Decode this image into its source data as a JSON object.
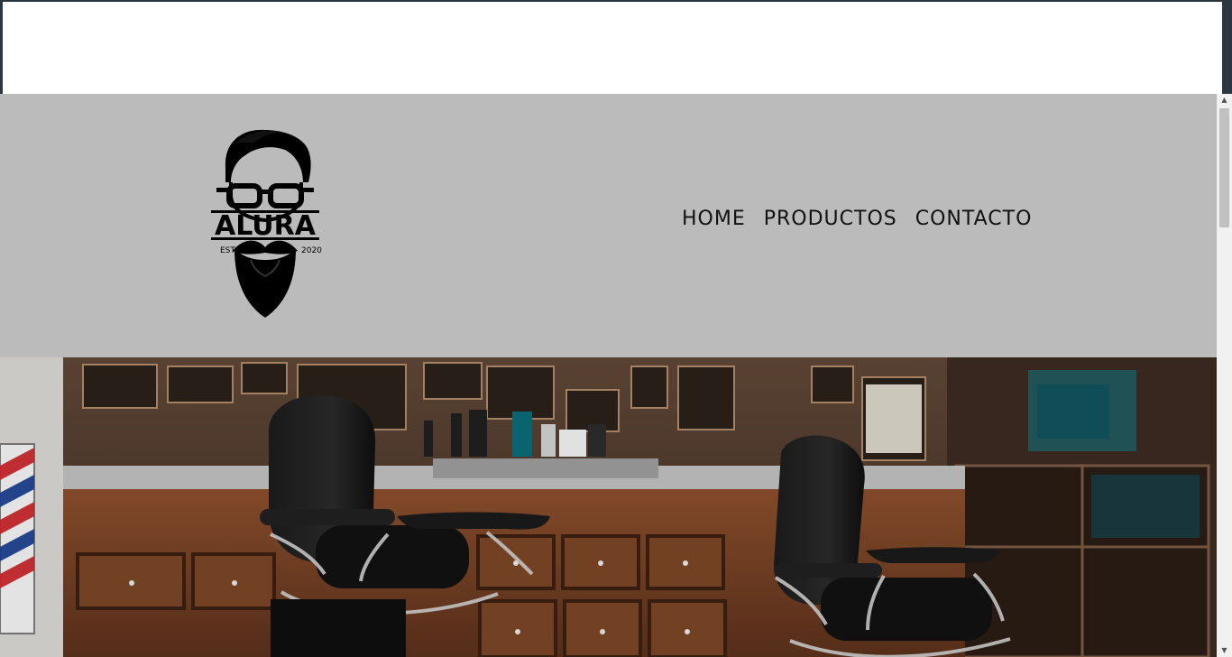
{
  "logo": {
    "name": "ALURA",
    "left_text": "ESTD",
    "right_text": "2020"
  },
  "nav": {
    "items": [
      {
        "label": "HOME"
      },
      {
        "label": "PRODUCTOS"
      },
      {
        "label": "CONTACTO"
      }
    ]
  },
  "hero": {
    "icon": "barbershop-photo",
    "accent": "#bbbbbb"
  },
  "scrollbar": {
    "up_icon": "chevron-up-icon",
    "down_icon": "chevron-down-icon"
  }
}
